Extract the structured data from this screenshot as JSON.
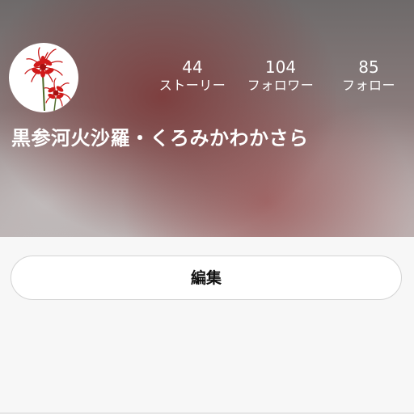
{
  "profile": {
    "display_name": "黒参河火沙羅・くろみかわかさら",
    "avatar_icon": "red-spider-lily-icon",
    "stats": [
      {
        "count": "44",
        "label": "ストーリー"
      },
      {
        "count": "104",
        "label": "フォロワー"
      },
      {
        "count": "85",
        "label": "フォロー"
      }
    ]
  },
  "actions": {
    "edit_label": "編集"
  },
  "colors": {
    "header_tint": "#7d3c3c",
    "text_on_header": "#ffffff",
    "page_background": "#f7f7f7",
    "button_border": "#d4d4d4",
    "lily_red": "#d01a1a"
  }
}
